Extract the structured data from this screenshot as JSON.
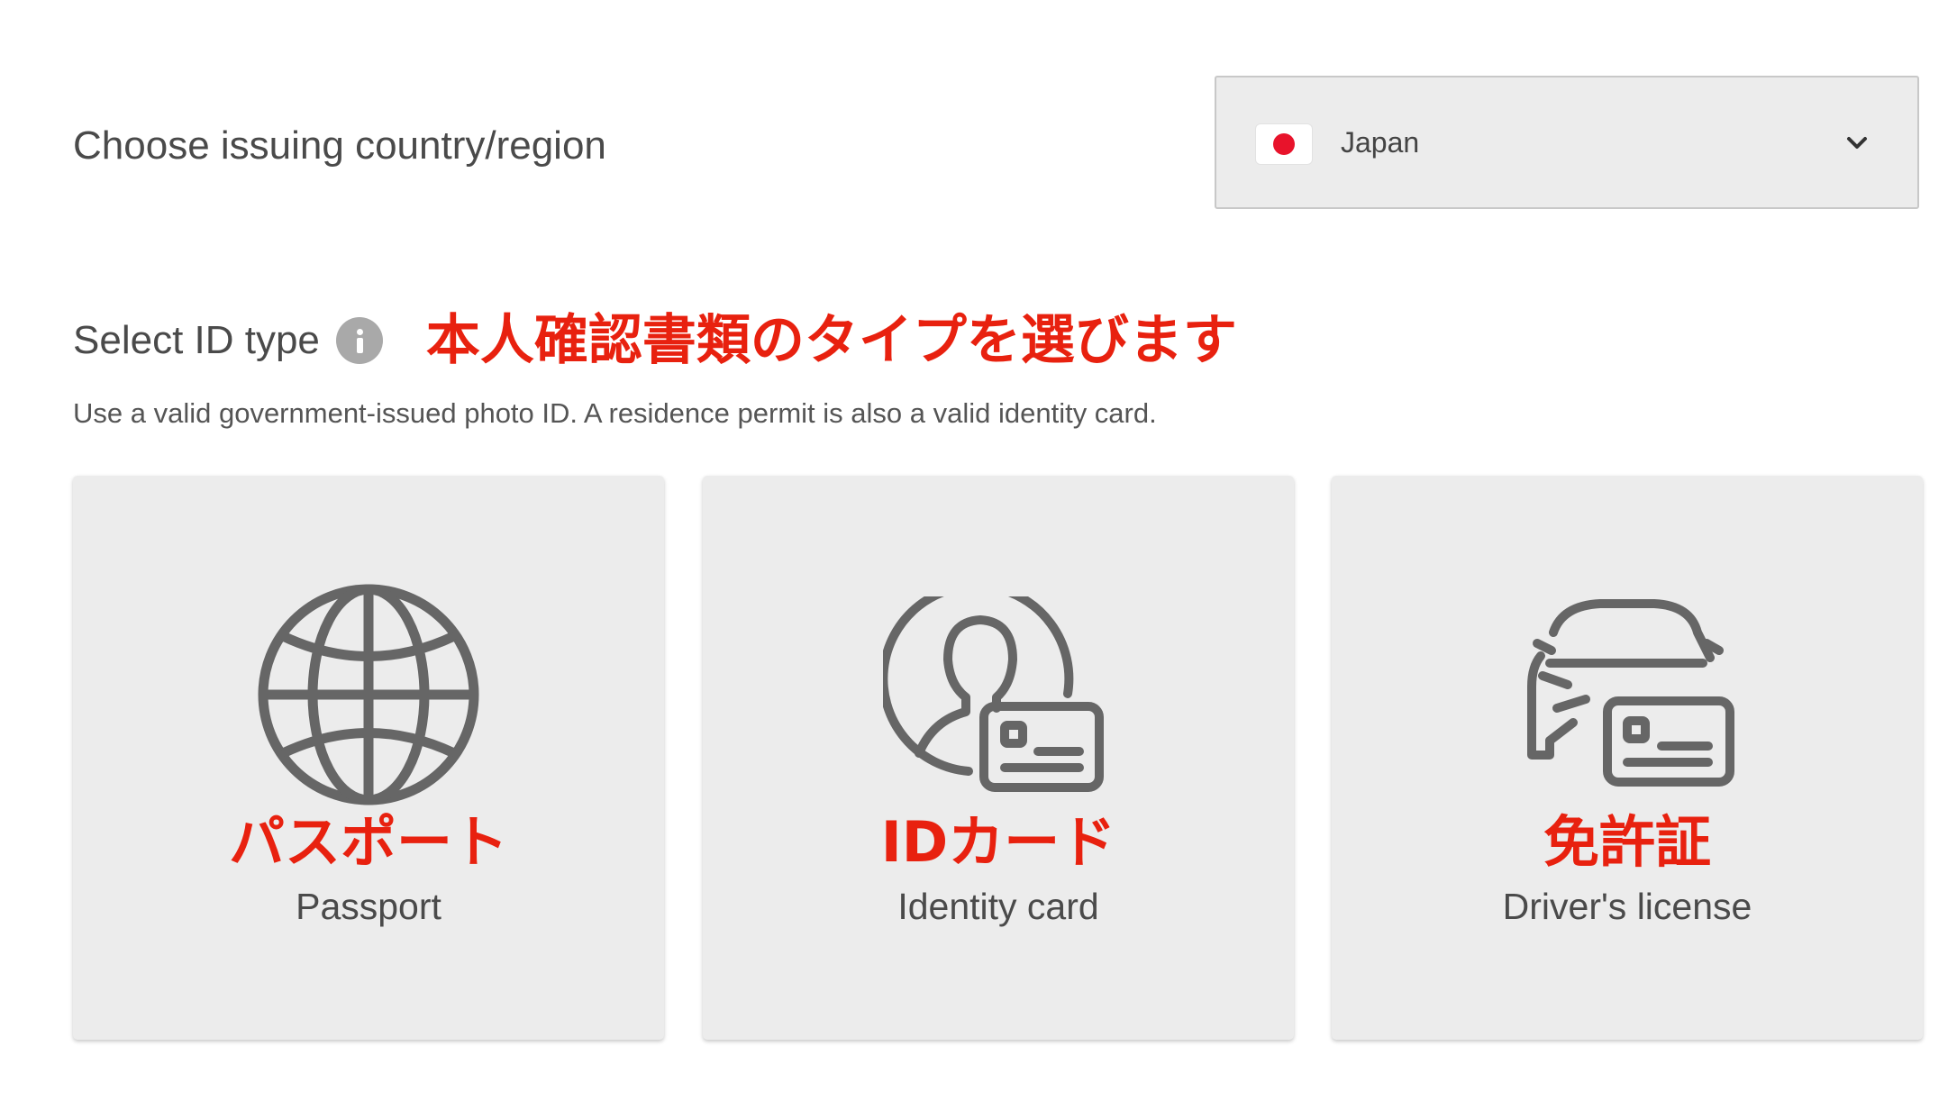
{
  "country_section": {
    "label": "Choose issuing country/region",
    "selected_value": "Japan",
    "flag_icon": "japan-flag-icon",
    "dropdown_icon": "chevron-down-icon"
  },
  "id_type_section": {
    "title": "Select ID type",
    "info_icon": "info-icon",
    "annotation_jp": "本人確認書類のタイプを選びます",
    "description": "Use a valid government-issued photo ID. A residence permit is also a valid identity card."
  },
  "id_types": [
    {
      "icon": "globe-icon",
      "label_jp": "パスポート",
      "label": "Passport"
    },
    {
      "icon": "identity-card-icon",
      "label_jp": "IDカード",
      "label": "Identity card"
    },
    {
      "icon": "car-license-icon",
      "label_jp": "免許証",
      "label": "Driver's license"
    }
  ],
  "colors": {
    "annotation_red": "#e8210f",
    "card_bg": "#ececec",
    "icon_gray": "#666666",
    "flag_red": "#e8132b"
  }
}
